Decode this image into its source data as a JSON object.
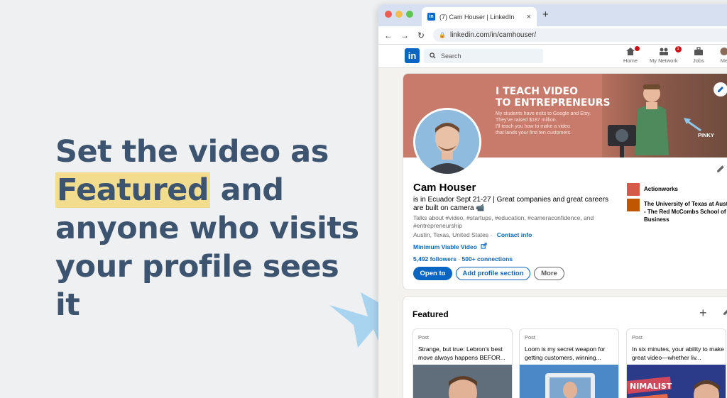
{
  "slide": {
    "line1": "Set the video as",
    "line2_highlight": "Featured",
    "line2_rest": " and",
    "line3": "anyone who visits",
    "line4": "your profile sees it",
    "highlight_color": "#f2dc8e",
    "text_color": "#3c5470"
  },
  "browser": {
    "tab_title": "(7) Cam Houser | LinkedIn",
    "tab_close": "×",
    "new_tab": "+",
    "url": "linkedin.com/in/camhouser/",
    "back": "←",
    "forward": "→",
    "reload": "↻"
  },
  "linkedin_nav": {
    "logo": "in",
    "search_placeholder": "Search",
    "items": [
      {
        "label": "Home",
        "icon": "home-icon",
        "badge": ""
      },
      {
        "label": "My Network",
        "icon": "network-icon",
        "badge": "1"
      },
      {
        "label": "Jobs",
        "icon": "briefcase-icon",
        "badge": ""
      },
      {
        "label": "Me",
        "icon": "me-icon",
        "badge": ""
      }
    ],
    "accent": "#0a66c2"
  },
  "banner": {
    "slogan_line1": "I TEACH VIDEO",
    "slogan_line2": "TO ENTREPRENEURS",
    "sub_line1": "My students have exits to Google and Etsy.",
    "sub_line2": "They've raised $187 million.",
    "sub_line3": "I'll teach you how to make a video",
    "sub_line4": "that lands your first ten customers.",
    "pinky_label": "PINKY",
    "bg_color": "#c87a6b"
  },
  "profile": {
    "name": "Cam Houser",
    "headline": "is in Ecuador Sept 21-27 | Great companies and great careers are built on camera 📹",
    "talks_about": "Talks about #video, #startups, #education, #cameraconfidence, and #entrepreneurship",
    "location": "Austin, Texas, United States",
    "contact_info": "Contact info",
    "website": "Minimum Viable Video",
    "followers": "5,492 followers",
    "connections": "500+ connections",
    "btn_open": "Open to",
    "btn_add": "Add profile section",
    "btn_more": "More",
    "experience": [
      {
        "name": "Actionworks",
        "logo_color": "#d45a4a"
      },
      {
        "name": "The University of Texas at Austin - The Red McCombs School of Business",
        "logo_color": "#bf5700"
      }
    ]
  },
  "featured": {
    "title": "Featured",
    "items": [
      {
        "type": "Post",
        "text": "Strange, but true: Lebron's best move always happens BEFOR..."
      },
      {
        "type": "Post",
        "text": "Loom is my secret weapon for getting customers, winning..."
      },
      {
        "type": "Post",
        "text": "In six minutes, your ability to make great video—whether liv..."
      }
    ],
    "thumb3_text": "NIMALIST"
  }
}
